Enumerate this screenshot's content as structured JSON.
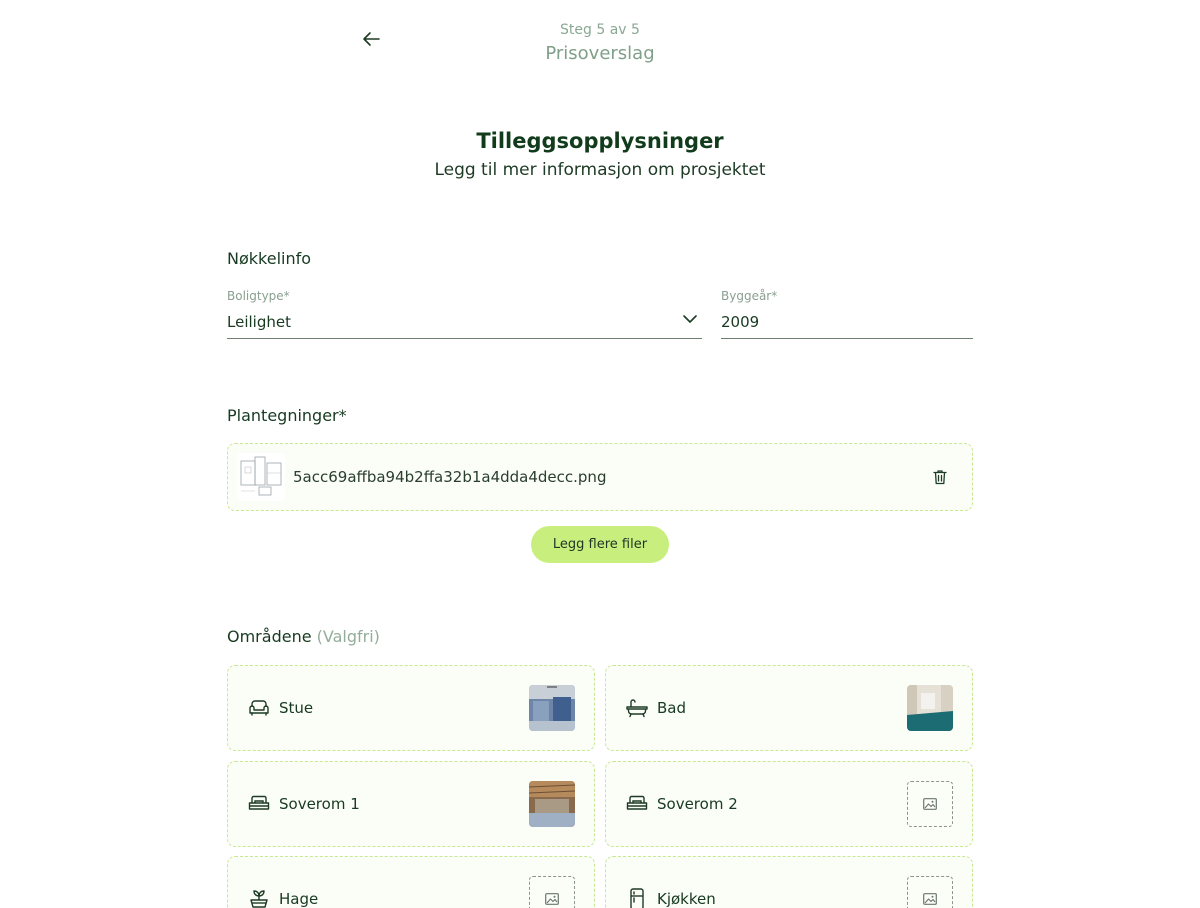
{
  "header": {
    "step": "Steg 5 av 5",
    "title": "Prisoverslag"
  },
  "page": {
    "title": "Tilleggsopplysninger",
    "subtitle": "Legg til mer informasjon om prosjektet"
  },
  "key_info": {
    "title": "Nøkkelinfo",
    "housing_type": {
      "label": "Boligtype*",
      "value": "Leilighet"
    },
    "build_year": {
      "label": "Byggeår*",
      "value": "2009"
    }
  },
  "floor_plans": {
    "title": "Plantegninger*",
    "file_name": "5acc69affba94b2ffa32b1a4dda4decc.png",
    "add_button": "Legg flere filer"
  },
  "areas": {
    "title": "Områdene",
    "optional": "(Valgfri)",
    "items": [
      {
        "label": "Stue",
        "icon": "armchair-icon",
        "has_photo": true
      },
      {
        "label": "Bad",
        "icon": "bathtub-icon",
        "has_photo": true
      },
      {
        "label": "Soverom 1",
        "icon": "bed-icon",
        "has_photo": true
      },
      {
        "label": "Soverom 2",
        "icon": "bed-icon",
        "has_photo": false
      },
      {
        "label": "Hage",
        "icon": "plant-icon",
        "has_photo": false
      },
      {
        "label": "Kjøkken",
        "icon": "fridge-icon",
        "has_photo": false
      }
    ]
  },
  "colors": {
    "accent_button": "#c8ef7e",
    "dashed_border": "#c8e893",
    "heading": "#123b1c"
  }
}
